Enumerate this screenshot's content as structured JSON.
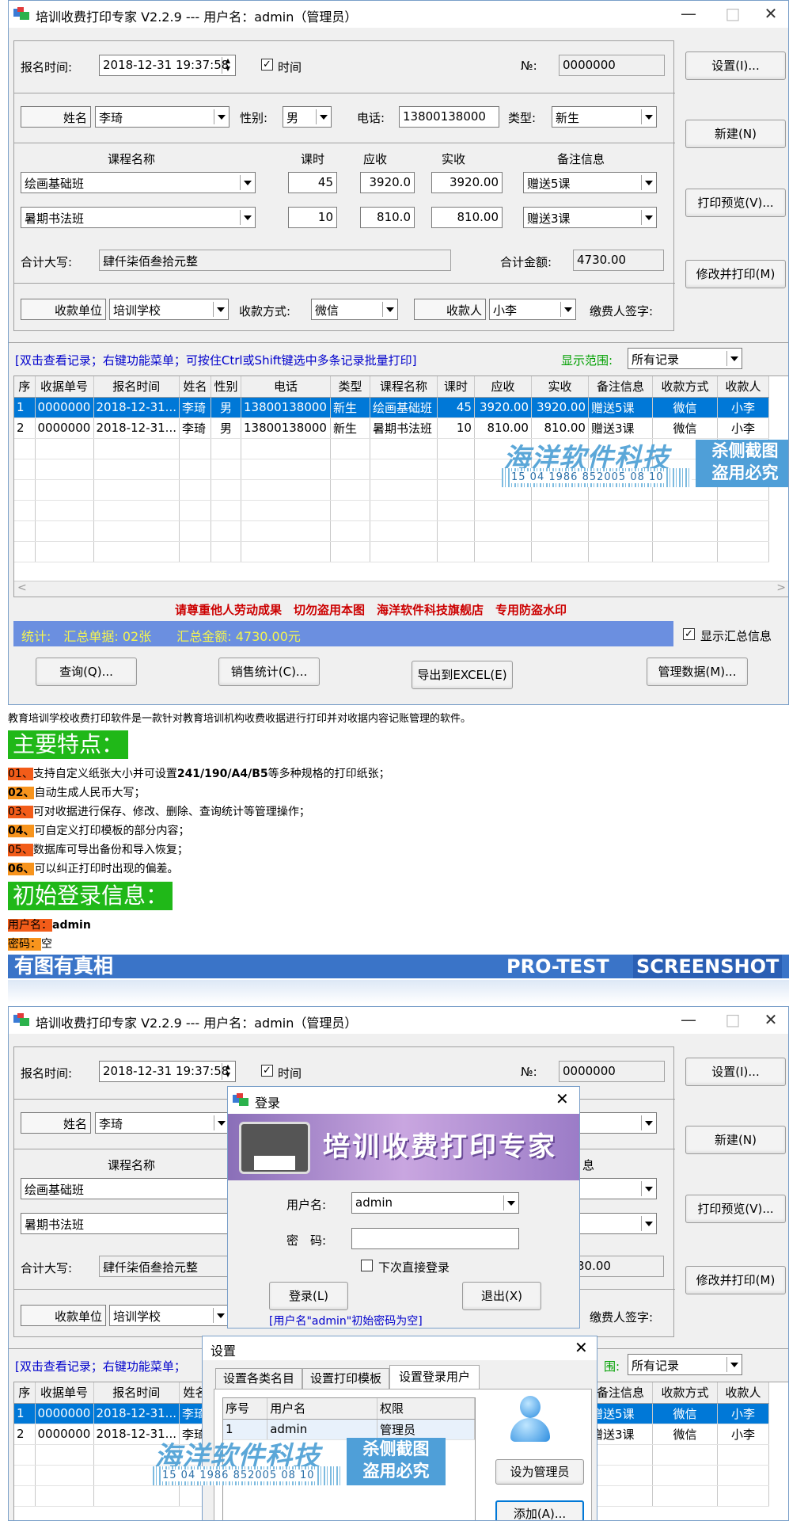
{
  "window": {
    "title": "培训收费打印专家 V2.2.9 --- 用户名：admin（管理员）",
    "minimize": "—",
    "maximize": "□",
    "close": "✕"
  },
  "form": {
    "reg_time_label": "报名时间:",
    "reg_time_value": "2018-12-31 19:37:58",
    "time_checkbox_label": "时间",
    "no_label": "№:",
    "no_value": "0000000",
    "name_label": "姓名",
    "name_value": "李琦",
    "gender_label": "性别:",
    "gender_value": "男",
    "phone_label": "电话:",
    "phone_value": "13800138000",
    "type_label": "类型:",
    "type_value": "新生",
    "course_headers": {
      "name": "课程名称",
      "hours": "课时",
      "due": "应收",
      "paid": "实收",
      "remark": "备注信息"
    },
    "courses": [
      {
        "name": "绘画基础班",
        "hours": "45",
        "due": "3920.0",
        "paid": "3920.00",
        "remark": "赠送5课"
      },
      {
        "name": "暑期书法班",
        "hours": "10",
        "due": "810.0",
        "paid": "810.00",
        "remark": "赠送3课"
      }
    ],
    "total_upper_label": "合计大写:",
    "total_upper_value": "肆仟柒佰叁拾元整",
    "total_amount_label": "合计金额:",
    "total_amount_value": "4730.00",
    "payee_unit_label": "收款单位",
    "payee_unit_value": "培训学校",
    "pay_method_label": "收款方式:",
    "pay_method_value": "微信",
    "collector_label": "收款人",
    "collector_value": "小李",
    "signature_label": "缴费人签字:"
  },
  "side_buttons": {
    "settings": "设置(I)...",
    "new": "新建(N)",
    "preview": "打印预览(V)...",
    "modify_print": "修改并打印(M)"
  },
  "records": {
    "hint": "[双击查看记录；右键功能菜单；可按住Ctrl或Shift键选中多条记录批量打印]",
    "range_label": "显示范围:",
    "range_value": "所有记录",
    "columns": [
      "序",
      "收据单号",
      "报名时间",
      "姓名",
      "性别",
      "电话",
      "类型",
      "课程名称",
      "课时",
      "应收",
      "实收",
      "备注信息",
      "收款方式",
      "收款人"
    ],
    "rows": [
      [
        "1",
        "0000000",
        "2018-12-31...",
        "李琦",
        "男",
        "13800138000",
        "新生",
        "绘画基础班",
        "45",
        "3920.00",
        "3920.00",
        "赠送5课",
        "微信",
        "小李"
      ],
      [
        "2",
        "0000000",
        "2018-12-31...",
        "李琦",
        "男",
        "13800138000",
        "新生",
        "暑期书法班",
        "10",
        "810.00",
        "810.00",
        "赠送3课",
        "微信",
        "小李"
      ]
    ],
    "antitheft": "请尊重他人劳动成果　切勿盗用本图　海洋软件科技旗舰店　专用防盗水印",
    "summary": "统计:　汇总单据: 02张　　汇总金额: 4730.00元",
    "show_summary_label": "显示汇总信息",
    "bottom_buttons": {
      "query": "查询(Q)...",
      "stats": "销售统计(C)...",
      "export": "导出到EXCEL(E)",
      "manage": "管理数据(M)..."
    }
  },
  "watermark": {
    "company": "海洋软件科技",
    "code": "15 04 1986 852005 08 10",
    "tag_line1": "杀侧截图",
    "tag_line2": "盗用必究"
  },
  "article": {
    "intro": "教育培训学校收费打印软件是一款针对教育培训机构收费收据进行打印并对收据内容记账管理的软件。",
    "features_title": "主要特点：",
    "features": [
      {
        "num": "01、",
        "pre": "支持自定义纸张大小并可设置",
        "bold": "241/190/A4/B5",
        "post": "等多种规格的打印纸张；"
      },
      {
        "num": "02、",
        "pre": "自动生成人民币大写；",
        "bold": "",
        "post": ""
      },
      {
        "num": "03、",
        "pre": "可对收据进行保存、修改、删除、查询统计等管理操作；",
        "bold": "",
        "post": ""
      },
      {
        "num": "04、",
        "pre": "可自定义打印模板的部分内容；",
        "bold": "",
        "post": ""
      },
      {
        "num": "05、",
        "pre": "数据库可导出备份和导入恢复；",
        "bold": "",
        "post": ""
      },
      {
        "num": "06、",
        "pre": "可以纠正打印时出现的偏差。",
        "bold": "",
        "post": ""
      }
    ],
    "login_title": "初始登录信息：",
    "user_label": "用户名：",
    "user_value": "admin",
    "pwd_label": "密码：",
    "pwd_value": "空",
    "banner_left": "有图有真相",
    "banner_right1": "PRO-TEST",
    "banner_right2": "SCREENSHOT"
  },
  "login_dialog": {
    "title": "登录",
    "banner": "培训收费打印专家",
    "user_label": "用户名:",
    "user_value": "admin",
    "pwd_label": "密　码:",
    "pwd_value": "",
    "auto_login_label": "下次直接登录",
    "login_btn": "登录(L)",
    "exit_btn": "退出(X)",
    "hint": "[用户名\"admin\"初始密码为空]"
  },
  "settings_dialog": {
    "title": "设置",
    "tabs": [
      "设置各类名目",
      "设置打印模板",
      "设置登录用户"
    ],
    "columns": [
      "序号",
      "用户名",
      "权限"
    ],
    "rows": [
      [
        "1",
        "admin",
        "管理员"
      ]
    ],
    "set_admin_btn": "设为管理员",
    "add_btn": "添加(A)..."
  },
  "colors": {
    "selection": "#0078d7",
    "summary_bar": "#6b8fe0",
    "green_badge": "#20b818",
    "banner_blue": "#3a74c8"
  }
}
